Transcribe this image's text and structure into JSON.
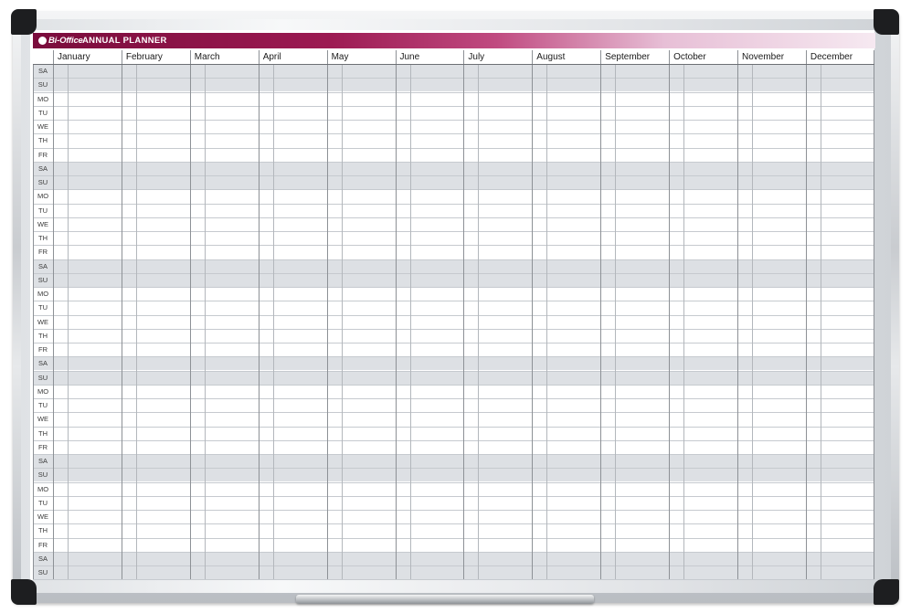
{
  "banner": {
    "logo_text": "Bi-Office",
    "title": "ANNUAL PLANNER"
  },
  "months": [
    "January",
    "February",
    "March",
    "April",
    "May",
    "June",
    "July",
    "August",
    "September",
    "October",
    "November",
    "December"
  ],
  "days": [
    "SA",
    "SU",
    "MO",
    "TU",
    "WE",
    "TH",
    "FR",
    "SA",
    "SU",
    "MO",
    "TU",
    "WE",
    "TH",
    "FR",
    "SA",
    "SU",
    "MO",
    "TU",
    "WE",
    "TH",
    "FR",
    "SA",
    "SU",
    "MO",
    "TU",
    "WE",
    "TH",
    "FR",
    "SA",
    "SU",
    "MO",
    "TU",
    "WE",
    "TH",
    "FR",
    "SA",
    "SU"
  ],
  "colors": {
    "banner_start": "#7a0c3c",
    "weekend_row": "#dde0e4",
    "frame": "#c9ccd0"
  }
}
